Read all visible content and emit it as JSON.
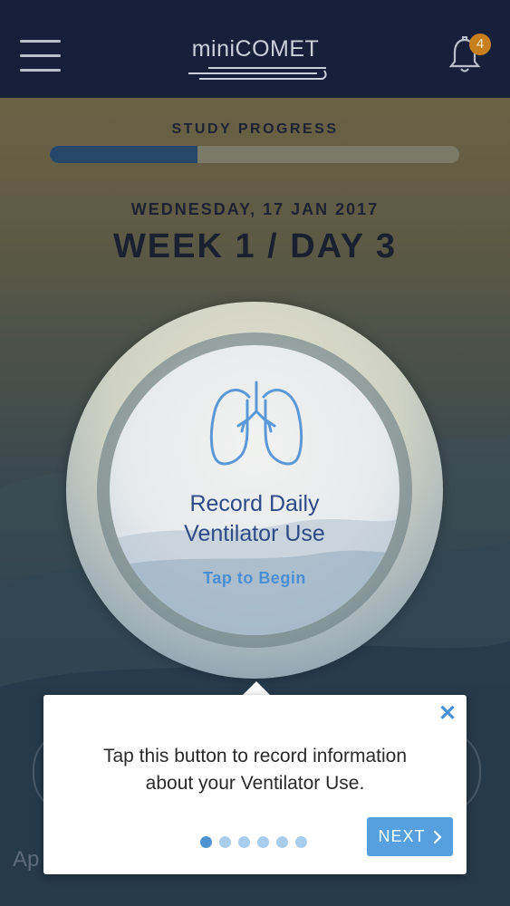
{
  "header": {
    "app_name_prefix": "mini",
    "app_name_main": "COMET",
    "notification_count": "4"
  },
  "progress": {
    "label": "STUDY PROGRESS",
    "fraction": 0.36
  },
  "date": "WEDNESDAY, 17 JAN 2017",
  "week_day": "WEEK 1 / DAY 3",
  "main_button": {
    "title_line1": "Record Daily",
    "title_line2": "Ventilator Use",
    "action": "Tap to Begin",
    "icon": "lungs-icon"
  },
  "bottom_partial_text": "Ap",
  "tooltip": {
    "text_line1": "Tap this button to record information",
    "text_line2": "about your Ventilator Use.",
    "close_icon": "close-icon",
    "next_label": "NEXT",
    "pager": {
      "total": 6,
      "current": 1
    }
  },
  "colors": {
    "header_bg": "#17203a",
    "accent_blue": "#56a0df",
    "badge": "#c8801e",
    "progress_fill": "#26466a"
  }
}
